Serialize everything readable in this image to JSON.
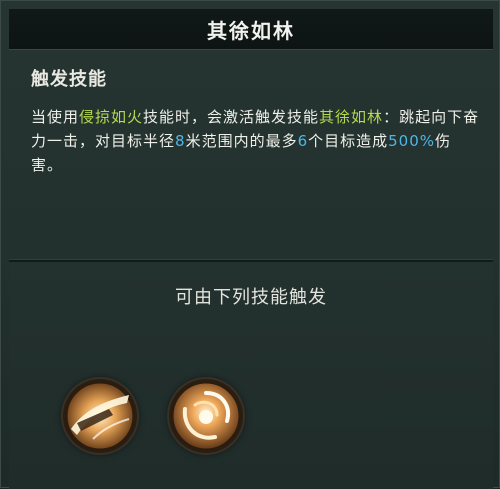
{
  "header": {
    "title": "其徐如林"
  },
  "section": {
    "title": "触发技能"
  },
  "description": {
    "p1": "当使用",
    "skill_trigger": "侵掠如火",
    "p2": "技能时，会激活触发技能",
    "skill_name": "其徐如林",
    "p3": "：跳起向下奋力一击，对目标半径",
    "radius": "8",
    "p4": "米范围内的最多",
    "targets": "6",
    "p5": "个目标造成",
    "damage": "500%",
    "p6": "伤害。"
  },
  "triggers": {
    "title": "可由下列技能触发",
    "icons": [
      "slash-skill-icon",
      "whirl-skill-icon"
    ]
  },
  "colors": {
    "highlight_skill": "#b5da4f",
    "highlight_number": "#4db8e8",
    "text": "#f0f0ea",
    "header_bg": "#111918",
    "panel_bg": "#22302e"
  }
}
